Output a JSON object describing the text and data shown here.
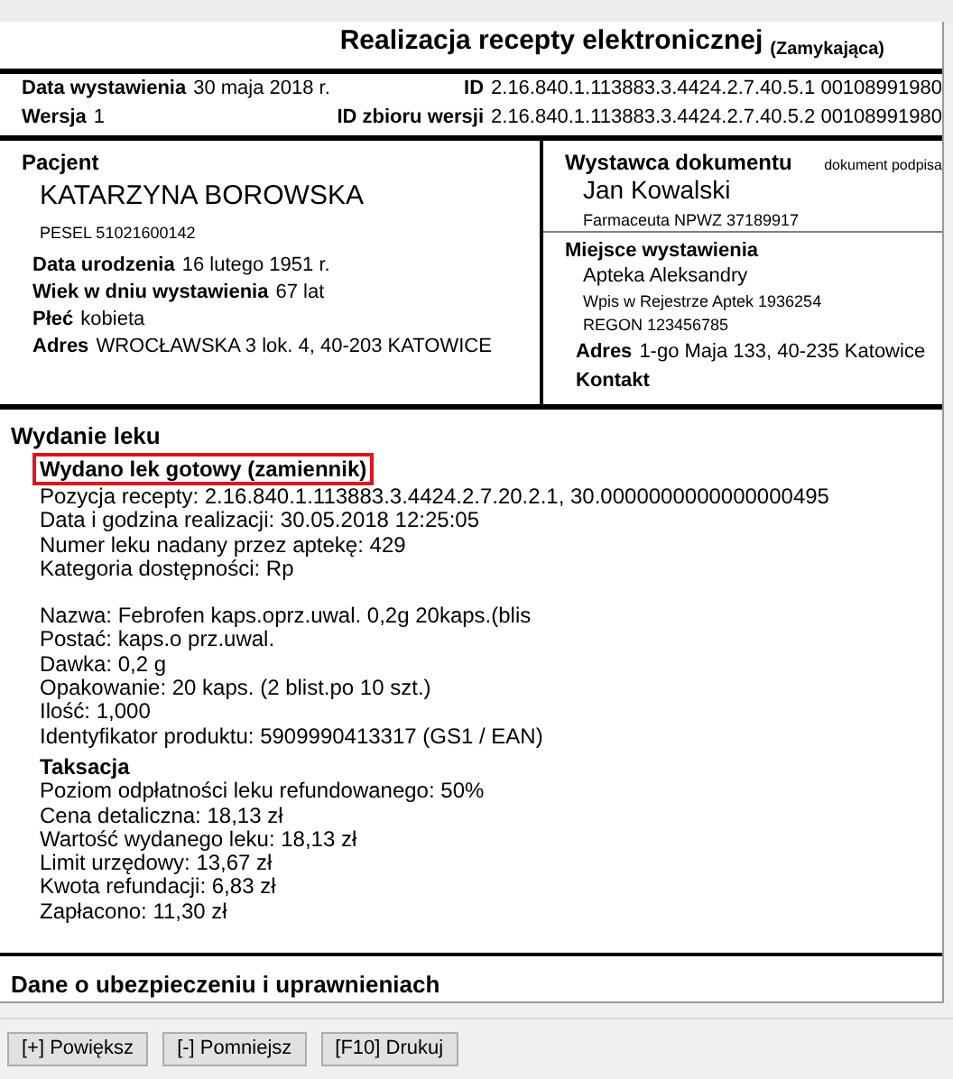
{
  "document": {
    "title": "Realizacja recepty elektronicznej",
    "subtitle": "(Zamykająca)",
    "header": [
      {
        "label": "Data wystawienia",
        "value": "30 maja 2018 r.",
        "id_label": "ID",
        "id_value": "2.16.840.1.113883.3.4424.2.7.40.5.1 00108991980"
      },
      {
        "label": "Wersja",
        "value": "1",
        "id_label": "ID zbioru wersji",
        "id_value": "2.16.840.1.113883.3.4424.2.7.40.5.2 00108991980"
      }
    ],
    "patient": {
      "heading": "Pacjent",
      "name": "KATARZYNA BOROWSKA",
      "pesel": "PESEL 51021600142",
      "fields": [
        {
          "label": "Data urodzenia",
          "value": "16 lutego 1951 r."
        },
        {
          "label": "Wiek w dniu wystawienia",
          "value": "67 lat"
        },
        {
          "label": "Płeć",
          "value": "kobieta"
        },
        {
          "label": "Adres",
          "value": "WROCŁAWSKA 3 lok. 4, 40-203 KATOWICE"
        }
      ]
    },
    "issuer": {
      "heading": "Wystawca dokumentu",
      "note": "dokument podpisa",
      "name": "Jan Kowalski",
      "detail": "Farmaceuta NPWZ 37189917"
    },
    "place": {
      "heading": "Miejsce wystawienia",
      "name": "Apteka Aleksandry",
      "lines": [
        "Wpis w Rejestrze Aptek 1936254",
        "REGON 123456785"
      ],
      "fields": [
        {
          "label": "Adres",
          "value": "1-go Maja 133, 40-235 Katowice"
        },
        {
          "label": "Kontakt"
        }
      ]
    },
    "dispense": {
      "heading": "Wydanie leku",
      "status": "Wydano lek gotowy (zamiennik)",
      "highlighted": true,
      "groups": [
        [
          "Pozycja recepty: 2.16.840.1.113883.3.4424.2.7.20.2.1, 30.0000000000000000495",
          "Data i godzina realizacji: 30.05.2018 12:25:05",
          "Numer leku nadany przez aptekę: 429",
          "Kategoria dostępności: Rp"
        ],
        [
          "Nazwa: Febrofen kaps.oprz.uwal. 0,2g 20kaps.(blis",
          "Postać: kaps.o prz.uwal.",
          "Dawka: 0,2 g",
          "Opakowanie: 20 kaps. (2 blist.po 10 szt.)",
          "Ilość: 1,000",
          "Identyfikator produktu: 5909990413317 (GS1 / EAN)"
        ]
      ],
      "taxation": {
        "heading": "Taksacja",
        "lines": [
          "Poziom odpłatności leku refundowanego: 50%",
          "Cena detaliczna: 18,13 zł",
          "Wartość wydanego leku: 18,13 zł",
          "Limit urzędowy: 13,67 zł",
          "Kwota refundacji: 6,83 zł",
          "Zapłacono: 11,30 zł"
        ]
      }
    },
    "insurance": {
      "heading": "Dane o ubezpieczeniu i uprawnieniach"
    }
  },
  "toolbar": {
    "buttons": [
      "[+] Powiększ",
      "[-] Pomniejsz",
      "[F10] Drukuj"
    ]
  }
}
